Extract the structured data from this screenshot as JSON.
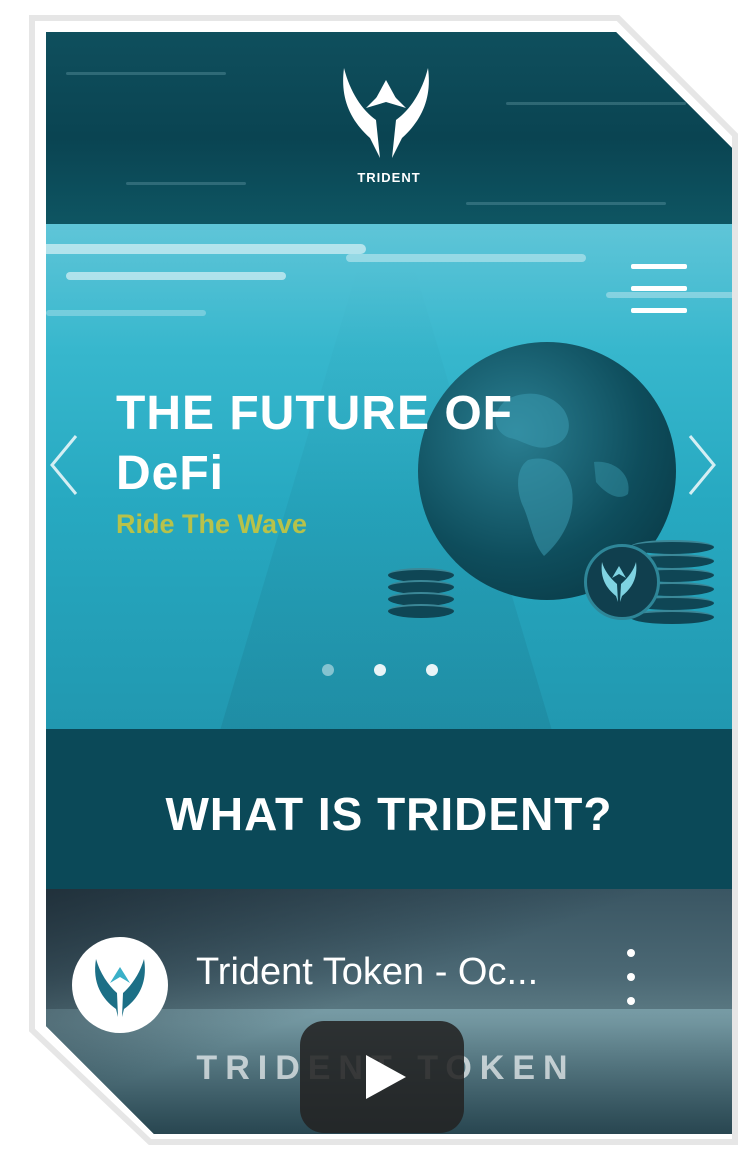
{
  "header": {
    "brand": "TRIDENT"
  },
  "hero": {
    "headline_line1": "THE FUTURE OF",
    "headline_line2": "DeFi",
    "tagline": "Ride The Wave",
    "slide_count": 3,
    "active_slide": 2
  },
  "section": {
    "title": "WHAT IS TRIDENT?"
  },
  "video": {
    "title": "Trident Token - Oc...",
    "wordmark": "TRIDENT TOKEN"
  },
  "colors": {
    "header_bg": "#0a4452",
    "hero_bg": "#27a9c1",
    "tagline": "#b7c24a",
    "section_bg": "#0b4958"
  },
  "icons": [
    "trident-logo-icon",
    "hamburger-menu-icon",
    "chevron-left-icon",
    "chevron-right-icon",
    "more-vert-icon",
    "play-icon"
  ]
}
